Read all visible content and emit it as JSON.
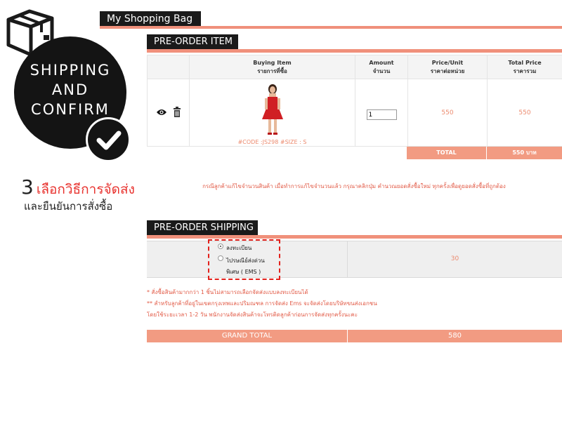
{
  "promo": {
    "circle_line1": "SHIPPING",
    "circle_line2": "AND",
    "circle_line3": "CONFIRM",
    "step_number": "3",
    "step_title": "เลือกวิธีการจัดส่ง",
    "step_subtitle": "และยืนยันการสั่งซื้อ"
  },
  "header": {
    "title": "My Shopping Bag"
  },
  "preorder_item": {
    "section_title": "PRE-ORDER ITEM",
    "columns": [
      {
        "en": "Buying Item",
        "th": "รายการที่ซื้อ"
      },
      {
        "en": "Amount",
        "th": "จำนวน"
      },
      {
        "en": "Price/Unit",
        "th": "ราคาต่อหน่วย"
      },
      {
        "en": "Total Price",
        "th": "ราคารวม"
      }
    ],
    "item": {
      "code_size": "#CODE :JS298 #SIZE : S",
      "amount": "1",
      "price_unit": "550",
      "total_price": "550"
    },
    "total_label": "TOTAL",
    "total_value": "550 บาท",
    "note": "กรณีลูกค้าแก้ไขจำนวนสินค้า เมื่อทำการแก้ไขจำนวนแล้ว กรุณาคลิกปุ่ม คำนวณยอดสั่งซื้อใหม่ ทุกครั้งเพื่อดูยอดสั่งซื้อที่ถูกต้อง"
  },
  "preorder_shipping": {
    "section_title": "PRE-ORDER SHIPPING",
    "options": [
      {
        "label": "ลงทะเบียน",
        "selected": true
      },
      {
        "label_line1": "ไปรษณีย์ส่งด่วน",
        "label_line2": "พิเศษ ( EMS )",
        "selected": false
      }
    ],
    "shipping_cost": "30",
    "footnotes": [
      "* สั่งซื้อสินค้ามากกว่า 1 ชิ้นไม่สามารถเลือกจัดส่งแบบลงทะเบียนได้",
      "** สำหรับลูกค้าที่อยู่ในเขตกรุงเทพและปริมณฑล การจัดส่ง Ems จะจัดส่งโดยบริษัทขนส่งเอกชน",
      "โดยใช้ระยะเวลา 1-2 วัน พนักงานจัดส่งสินค้าจะโทรติดลูกค้าก่อนการจัดส่งทุกครั้งนะคะ"
    ],
    "grand_total_label": "GRAND TOTAL",
    "grand_total_value": "580"
  },
  "icons": {
    "box": "box-icon",
    "check": "check-icon",
    "view": "eye-icon",
    "delete": "trash-icon"
  },
  "colors": {
    "accent_salmon": "#f0907b",
    "accent_red": "#e3201b",
    "dark": "#141414"
  }
}
